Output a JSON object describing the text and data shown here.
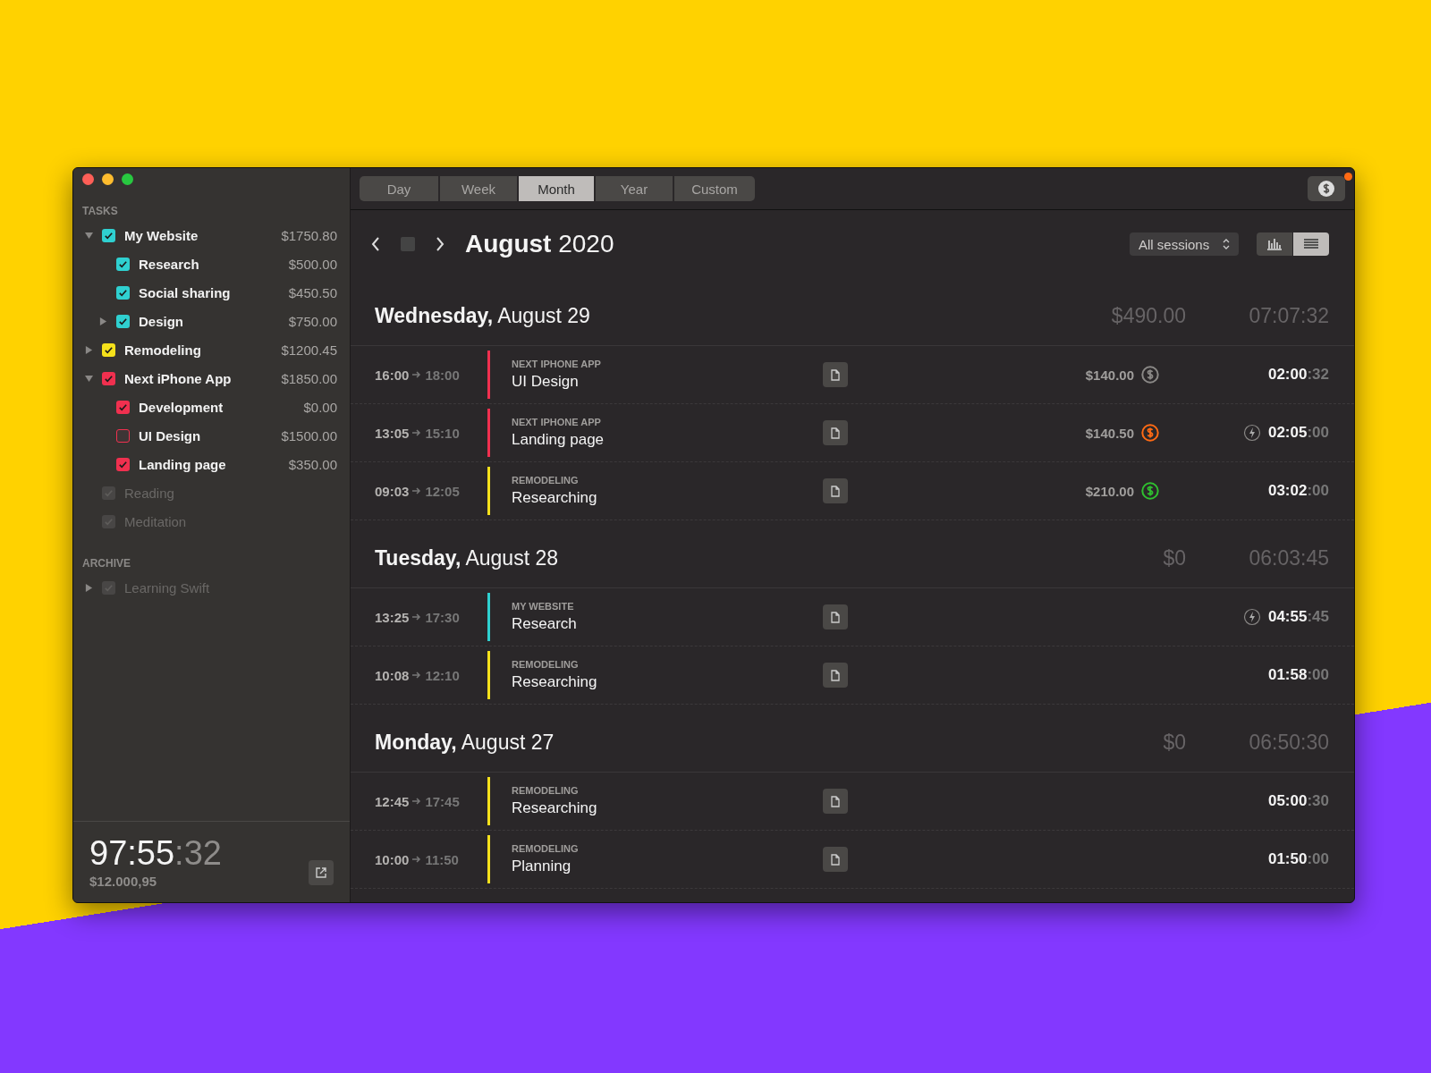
{
  "sidebar": {
    "sections": [
      {
        "title": "TASKS",
        "items": [
          {
            "name": "My Website",
            "amount": "$1750.80",
            "color": "#2fd0d0",
            "checked": true,
            "disabled": false,
            "expanded": true,
            "children": [
              {
                "name": "Research",
                "amount": "$500.00",
                "color": "#2fd0d0",
                "checked": true,
                "disabled": false
              },
              {
                "name": "Social sharing",
                "amount": "$450.50",
                "color": "#2fd0d0",
                "checked": true,
                "disabled": false
              },
              {
                "name": "Design",
                "amount": "$750.00",
                "color": "#2fd0d0",
                "checked": true,
                "disabled": false,
                "expanded": false
              }
            ]
          },
          {
            "name": "Remodeling",
            "amount": "$1200.45",
            "color": "#f5e11b",
            "checked": true,
            "disabled": false,
            "expanded": false
          },
          {
            "name": "Next iPhone App",
            "amount": "$1850.00",
            "color": "#f0304f",
            "checked": true,
            "disabled": false,
            "expanded": true,
            "children": [
              {
                "name": "Development",
                "amount": "$0.00",
                "color": "#f0304f",
                "checked": true,
                "disabled": false
              },
              {
                "name": "UI Design",
                "amount": "$1500.00",
                "color": "#f0304f",
                "checked": false,
                "disabled": false
              },
              {
                "name": "Landing page",
                "amount": "$350.00",
                "color": "#f0304f",
                "checked": true,
                "disabled": false
              }
            ]
          },
          {
            "name": "Reading",
            "color": "#555353",
            "checked": true,
            "disabled": true
          },
          {
            "name": "Meditation",
            "color": "#555353",
            "checked": true,
            "disabled": true
          }
        ]
      },
      {
        "title": "ARCHIVE",
        "items": [
          {
            "name": "Learning Swift",
            "color": "#555353",
            "checked": true,
            "disabled": true,
            "expanded": false
          }
        ]
      }
    ],
    "footer": {
      "time": "97:55",
      "seconds": ":32",
      "amount": "$12.000,95"
    }
  },
  "tabs": [
    {
      "label": "Day",
      "selected": false
    },
    {
      "label": "Week",
      "selected": false
    },
    {
      "label": "Month",
      "selected": true
    },
    {
      "label": "Year",
      "selected": false
    },
    {
      "label": "Custom",
      "selected": false
    }
  ],
  "billing_button": {
    "notification": true
  },
  "period": {
    "month": "August",
    "year": "2020"
  },
  "filter": {
    "value": "All sessions"
  },
  "views": [
    {
      "kind": "chart",
      "selected": false
    },
    {
      "kind": "list",
      "selected": true
    }
  ],
  "days": [
    {
      "weekday": "Wednesday,",
      "date": "August 29",
      "amount": "$490.00",
      "time": "07:07:32",
      "sessions": [
        {
          "start": "16:00",
          "end": "18:00",
          "project": "NEXT IPHONE APP",
          "task": "UI Design",
          "color": "#f0304f",
          "amount": "$140.00",
          "coin": {
            "color": "#8a8886"
          },
          "boosted": false,
          "duration": "02:00",
          "seconds": ":32"
        },
        {
          "start": "13:05",
          "end": "15:10",
          "project": "NEXT IPHONE APP",
          "task": "Landing page",
          "color": "#f0304f",
          "amount": "$140.50",
          "coin": {
            "color": "#ff6a14"
          },
          "boosted": true,
          "duration": "02:05",
          "seconds": ":00"
        },
        {
          "start": "09:03",
          "end": "12:05",
          "project": "REMODELING",
          "task": "Researching",
          "color": "#f5e11b",
          "amount": "$210.00",
          "coin": {
            "color": "#2fbf2f"
          },
          "boosted": false,
          "duration": "03:02",
          "seconds": ":00"
        }
      ]
    },
    {
      "weekday": "Tuesday,",
      "date": "August 28",
      "amount": "$0",
      "time": "06:03:45",
      "sessions": [
        {
          "start": "13:25",
          "end": "17:30",
          "project": "MY WEBSITE",
          "task": "Research",
          "color": "#2fd0d0",
          "boosted": true,
          "duration": "04:55",
          "seconds": ":45"
        },
        {
          "start": "10:08",
          "end": "12:10",
          "project": "REMODELING",
          "task": "Researching",
          "color": "#f5e11b",
          "boosted": false,
          "duration": "01:58",
          "seconds": ":00"
        }
      ]
    },
    {
      "weekday": "Monday,",
      "date": "August 27",
      "amount": "$0",
      "time": "06:50:30",
      "sessions": [
        {
          "start": "12:45",
          "end": "17:45",
          "project": "REMODELING",
          "task": "Researching",
          "color": "#f5e11b",
          "boosted": false,
          "duration": "05:00",
          "seconds": ":30"
        },
        {
          "start": "10:00",
          "end": "11:50",
          "project": "REMODELING",
          "task": "Planning",
          "color": "#f5e11b",
          "boosted": false,
          "duration": "01:50",
          "seconds": ":00"
        }
      ]
    }
  ]
}
